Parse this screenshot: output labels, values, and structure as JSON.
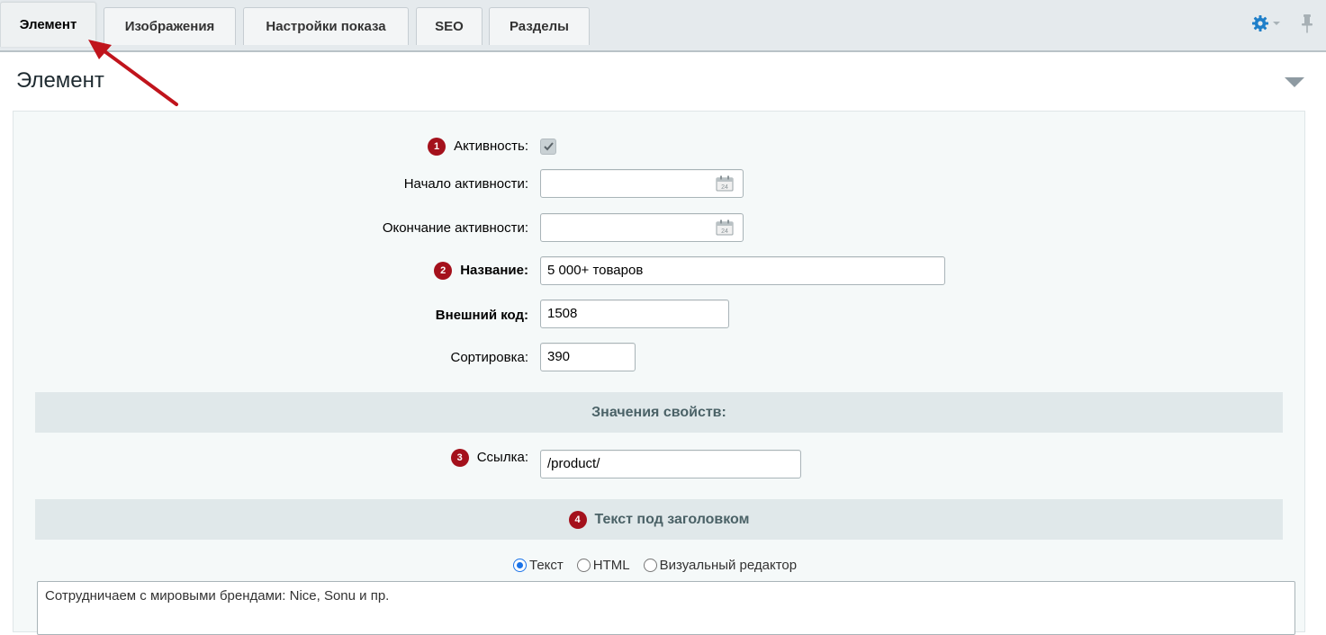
{
  "tabs": [
    {
      "label": "Элемент",
      "active": true
    },
    {
      "label": "Изображения",
      "active": false
    },
    {
      "label": "Настройки показа",
      "active": false
    },
    {
      "label": "SEO",
      "active": false
    },
    {
      "label": "Разделы",
      "active": false
    }
  ],
  "toolbar": {
    "settings_icon": "gear-icon",
    "pin_icon": "pin-icon"
  },
  "section": {
    "title": "Элемент"
  },
  "form": {
    "active": {
      "label": "Активность:",
      "badge": "1",
      "checked": true
    },
    "active_from": {
      "label": "Начало активности:",
      "value": ""
    },
    "active_to": {
      "label": "Окончание активности:",
      "value": ""
    },
    "name": {
      "label": "Название:",
      "badge": "2",
      "value": "5 000+ товаров"
    },
    "xml_id": {
      "label": "Внешний код:",
      "value": "1508"
    },
    "sort": {
      "label": "Сортировка:",
      "value": "390"
    }
  },
  "properties": {
    "header": "Значения свойств:",
    "link": {
      "label": "Ссылка:",
      "badge": "3",
      "value": "/product/"
    }
  },
  "subtitle_text": {
    "header": "Текст под заголовком",
    "badge": "4",
    "modes": [
      "Текст",
      "HTML",
      "Визуальный редактор"
    ],
    "selected_mode": "Текст",
    "value": "Сотрудничаем с мировыми брендами: Nice, Sonu и пр."
  },
  "colors": {
    "badge": "#a4111c",
    "accent": "#1a73e8",
    "annotation_arrow": "#c0141c"
  }
}
